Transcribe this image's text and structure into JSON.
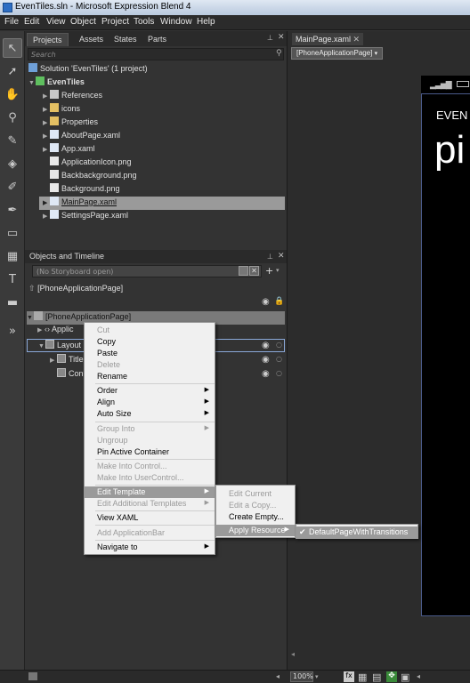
{
  "window": {
    "title": "EvenTiles.sln - Microsoft Expression Blend 4"
  },
  "menu": [
    "File",
    "Edit",
    "View",
    "Object",
    "Project",
    "Tools",
    "Window",
    "Help"
  ],
  "projects_panel": {
    "tabs": [
      "Projects",
      "Assets",
      "States",
      "Parts"
    ],
    "search_placeholder": "Search",
    "solution": "Solution 'EvenTiles' (1 project)",
    "project": "EvenTiles",
    "items": [
      "References",
      "icons",
      "Properties",
      "AboutPage.xaml",
      "App.xaml",
      "ApplicationIcon.png",
      "Backbackground.png",
      "Background.png",
      "MainPage.xaml",
      "SettingsPage.xaml"
    ],
    "selected_item": "MainPage.xaml"
  },
  "objects_panel": {
    "title": "Objects and Timeline",
    "storyboard": "(No Storyboard open)",
    "scope": "[PhoneApplicationPage]",
    "root": "[PhoneApplicationPage]",
    "children": [
      "Applic",
      "Layout",
      "Title",
      "Con"
    ]
  },
  "document": {
    "tab": "MainPage.xaml",
    "breadcrumb": "[PhoneApplicationPage]",
    "preview_title": "EVEN",
    "preview_big": "pi"
  },
  "status": {
    "zoom": "100%"
  },
  "context_menu": {
    "items": [
      {
        "label": "Cut",
        "enabled": false
      },
      {
        "label": "Copy",
        "enabled": true
      },
      {
        "label": "Paste",
        "enabled": true
      },
      {
        "label": "Delete",
        "enabled": false
      },
      {
        "label": "Rename",
        "enabled": true
      },
      {
        "label": "Order",
        "enabled": true,
        "submenu": true
      },
      {
        "label": "Align",
        "enabled": true,
        "submenu": true
      },
      {
        "label": "Auto Size",
        "enabled": true,
        "submenu": true
      },
      {
        "label": "Group Into",
        "enabled": false,
        "submenu": true
      },
      {
        "label": "Ungroup",
        "enabled": false
      },
      {
        "label": "Pin Active Container",
        "enabled": true
      },
      {
        "label": "Make Into Control...",
        "enabled": false
      },
      {
        "label": "Make Into UserControl...",
        "enabled": false
      },
      {
        "label": "Edit Template",
        "enabled": true,
        "submenu": true,
        "highlighted": true
      },
      {
        "label": "Edit Additional Templates",
        "enabled": false,
        "submenu": true
      },
      {
        "label": "View XAML",
        "enabled": true
      },
      {
        "label": "Add ApplicationBar",
        "enabled": false
      },
      {
        "label": "Navigate to",
        "enabled": true,
        "submenu": true
      }
    ]
  },
  "template_submenu": {
    "items": [
      {
        "label": "Edit Current",
        "enabled": false
      },
      {
        "label": "Edit a Copy...",
        "enabled": false
      },
      {
        "label": "Create Empty...",
        "enabled": true
      },
      {
        "label": "Apply Resource",
        "enabled": true,
        "submenu": true,
        "highlighted": true
      }
    ]
  },
  "resource_submenu": {
    "items": [
      {
        "label": "DefaultPageWithTransitions",
        "checked": true
      }
    ]
  }
}
